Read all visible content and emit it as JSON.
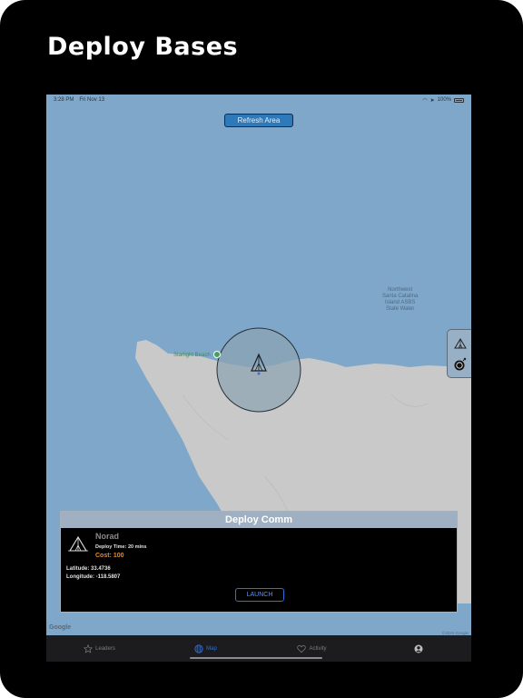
{
  "headline": "Deploy Bases",
  "status_bar": {
    "time": "3:28 PM",
    "date": "Fri Nov 13",
    "battery": "100%"
  },
  "map": {
    "refresh_button": "Refresh Area",
    "poi_label": "Starlight Beach",
    "area_label_lines": [
      "Northwest",
      "Santa Catalina",
      "Island ASBS",
      "State Water"
    ],
    "attribution_logo": "Google",
    "copyright": "©2020 Google",
    "colors": {
      "water": "#7fa7c9",
      "land": "#c9c9c9",
      "radius_fill": "#8aa3b1"
    }
  },
  "deploy_panel": {
    "title": "Deploy Comm",
    "unit_name": "Norad",
    "deploy_time": "Deploy Time: 20 mins",
    "cost": "Cost: 100",
    "latitude": "Latitude: 33.4736",
    "longitude": "Longitude: -118.5807",
    "launch_button": "LAUNCH",
    "icon": "tent-icon"
  },
  "side_panel": {
    "icons": [
      "tent-icon",
      "bomb-icon"
    ]
  },
  "tab_bar": {
    "tabs": [
      {
        "label": "Leaders",
        "icon": "star-icon",
        "active": false
      },
      {
        "label": "Map",
        "icon": "globe-icon",
        "active": true
      },
      {
        "label": "Activity",
        "icon": "heart-icon",
        "active": false
      },
      {
        "label": "",
        "icon": "profile-icon",
        "active": false
      }
    ]
  }
}
